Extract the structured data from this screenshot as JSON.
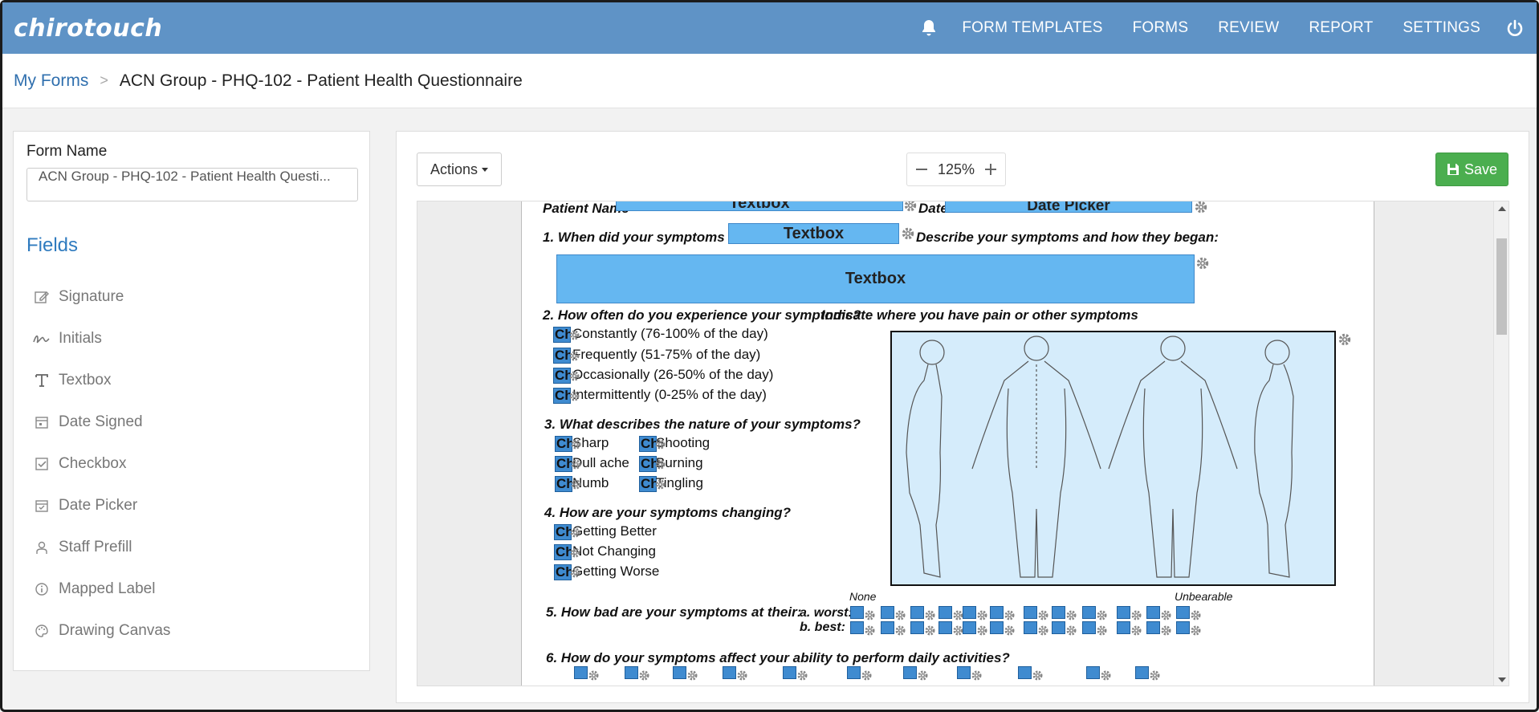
{
  "app": {
    "logo": "chirotouch"
  },
  "nav": {
    "items": [
      "FORM TEMPLATES",
      "FORMS",
      "REVIEW",
      "REPORT",
      "SETTINGS"
    ]
  },
  "breadcrumb": {
    "link": "My Forms",
    "separator": ">",
    "current": "ACN Group - PHQ-102 - Patient Health Questionnaire"
  },
  "left_panel": {
    "form_name_label": "Form Name",
    "form_name_value": "ACN Group - PHQ-102 - Patient Health Questi...",
    "fields_heading": "Fields",
    "fields": [
      {
        "label": "Signature",
        "icon": "signature-icon"
      },
      {
        "label": "Initials",
        "icon": "initials-icon"
      },
      {
        "label": "Textbox",
        "icon": "textbox-icon"
      },
      {
        "label": "Date Signed",
        "icon": "date-signed-icon"
      },
      {
        "label": "Checkbox",
        "icon": "checkbox-icon"
      },
      {
        "label": "Date Picker",
        "icon": "date-picker-icon"
      },
      {
        "label": "Staff Prefill",
        "icon": "staff-prefill-icon"
      },
      {
        "label": "Mapped Label",
        "icon": "info-icon"
      },
      {
        "label": "Drawing Canvas",
        "icon": "palette-icon"
      }
    ]
  },
  "toolbar": {
    "actions_label": "Actions",
    "zoom_level": "125%",
    "save_label": "Save"
  },
  "form": {
    "patient_name_label": "Patient Name",
    "patient_name_field": "Textbox",
    "date_label": "Date",
    "date_field": "Date Picker",
    "q1": "1. When did your symptoms start:",
    "q1_field": "Textbox",
    "q1_describe": "Describe your symptoms and how they began:",
    "q1_describe_field": "Textbox",
    "q2": "2. How often do you experience your symptoms?",
    "pain_label": "Indicate where you have pain or other symptoms",
    "q2_options": [
      "Constantly (76-100% of the day)",
      "Frequently (51-75% of the day)",
      "Occasionally (26-50% of the day)",
      "Intermittently (0-25% of the day)"
    ],
    "q3": "3. What describes the nature of your symptoms?",
    "q3_left": [
      "Sharp",
      "Dull ache",
      "Numb"
    ],
    "q3_right": [
      "Shooting",
      "Burning",
      "Tingling"
    ],
    "q4": "4. How are your symptoms changing?",
    "q4_options": [
      "Getting Better",
      "Not Changing",
      "Getting Worse"
    ],
    "q5": "5. How bad are your symptoms at their:",
    "q5_worst": "a. worst:",
    "q5_best": "b. best:",
    "scale_none": "None",
    "scale_unbearable": "Unbearable",
    "q6": "6. How do your symptoms affect your ability to perform daily activities?",
    "checkbox_prefix": "Ch"
  },
  "colors": {
    "topbar": "#5f93c6",
    "link": "#2f6fae",
    "field_blue": "#65b7f1",
    "save_green": "#4bae4f"
  }
}
